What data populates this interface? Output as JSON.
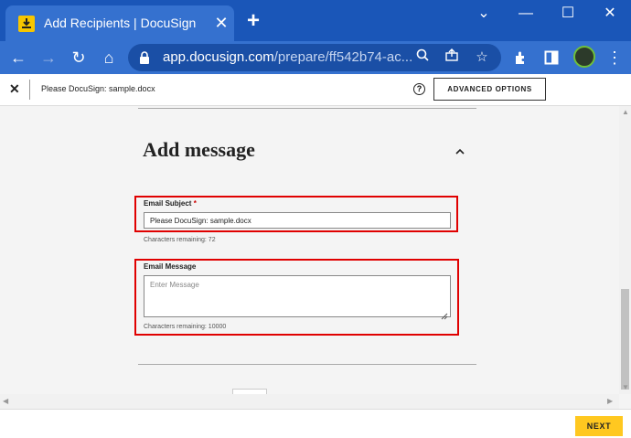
{
  "browser": {
    "tab_title": "Add Recipients | DocuSign",
    "url_host": "app.docusign.com",
    "url_path": "/prepare/ff542b74-ac...",
    "icons": [
      "docusign-favicon",
      "close-icon",
      "plus-icon",
      "chevron-down-icon",
      "minimize-icon",
      "maximize-icon",
      "close-window-icon",
      "back-arrow-icon",
      "forward-arrow-icon",
      "reload-icon",
      "home-icon",
      "lock-icon",
      "search-icon",
      "share-icon",
      "star-icon",
      "extensions-icon",
      "sidebar-icon",
      "profile-avatar",
      "kebab-menu-icon"
    ]
  },
  "header": {
    "document_name": "Please DocuSign: sample.docx",
    "help_glyph": "?",
    "advanced_options_label": "ADVANCED OPTIONS"
  },
  "message_section": {
    "title": "Add message",
    "email_subject": {
      "label": "Email Subject",
      "required_mark": "*",
      "value": "Please DocuSign: sample.docx",
      "hint": "Characters remaining: 72"
    },
    "email_message": {
      "label": "Email Message",
      "placeholder": "Enter Message",
      "hint": "Characters remaining: 10000"
    }
  },
  "footer": {
    "next_label": "NEXT"
  },
  "colors": {
    "chrome_blue": "#1a56b8",
    "highlight_red": "#e00000",
    "next_yellow": "#ffc820"
  }
}
